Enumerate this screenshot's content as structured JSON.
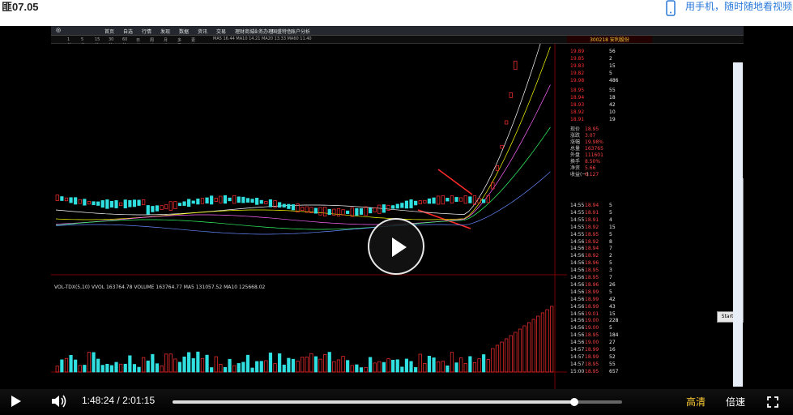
{
  "page": {
    "title": "匪07.05",
    "promo": "用手机，随时随地看视频"
  },
  "app": {
    "menu": [
      "首页",
      "自选",
      "行情",
      "发现",
      "数据",
      "资讯",
      "交易",
      "理财商城",
      "业务办理",
      "国盛特色",
      "账户分析"
    ],
    "periods": [
      "1分钟",
      "5分钟",
      "15分钟",
      "30分钟",
      "60分钟",
      "日线",
      "周线",
      "月线",
      "多周期",
      "更多"
    ],
    "chart_legend": "MA5 16.44  MA10 14.21  MA20 13.33  MA60 11.40",
    "volume_legend": "VOL-TDX(5,10)  VVOL 163764.78  VOLUME 163764.77  MA5 131057.52  MA10 125668.02",
    "indicator_tabs": [
      "指标A",
      "MACD",
      "DMI",
      "DMA",
      "FSL",
      "TRIX",
      "BRAR",
      "CR",
      "VR",
      "OBV",
      "ASI",
      "EMV",
      "VOL-TDX",
      "RSI",
      "WR",
      "SAR",
      "KDJ",
      "CCI",
      "ROC",
      "MTM",
      "BOLL",
      "PSY",
      "MCST",
      "更多"
    ]
  },
  "stock": {
    "code": "300218",
    "name": "安利股份",
    "asks": [
      {
        "label": "卖五",
        "price": "19.89",
        "vol": "56"
      },
      {
        "label": "卖四",
        "price": "19.85",
        "vol": "2"
      },
      {
        "label": "卖三",
        "price": "19.83",
        "vol": "15"
      },
      {
        "label": "卖二",
        "price": "19.82",
        "vol": "5"
      },
      {
        "label": "卖一",
        "price": "19.98",
        "vol": "486"
      }
    ],
    "bids": [
      {
        "label": "买一",
        "price": "18.95",
        "vol": "55"
      },
      {
        "label": "买二",
        "price": "18.94",
        "vol": "18"
      },
      {
        "label": "买三",
        "price": "18.93",
        "vol": "42"
      },
      {
        "label": "买四",
        "price": "18.92",
        "vol": "10"
      },
      {
        "label": "买五",
        "price": "18.91",
        "vol": "19"
      }
    ],
    "stats": [
      {
        "label": "现价",
        "value": "18.95"
      },
      {
        "label": "涨跌",
        "value": "3.07"
      },
      {
        "label": "涨幅",
        "value": "19.98%"
      },
      {
        "label": "总量",
        "value": "163765"
      },
      {
        "label": "外盘",
        "value": "111601"
      },
      {
        "label": "换手",
        "value": "8.50%"
      },
      {
        "label": "净资",
        "value": "5.66"
      },
      {
        "label": "收益(一)",
        "value": "0.127"
      }
    ],
    "trades": [
      {
        "time": "14:55",
        "price": "18.94",
        "vol": "5"
      },
      {
        "time": "14:55",
        "price": "18.91",
        "vol": "5"
      },
      {
        "time": "14:55",
        "price": "18.91",
        "vol": "4"
      },
      {
        "time": "14:55",
        "price": "18.92",
        "vol": "15"
      },
      {
        "time": "14:55",
        "price": "18.95",
        "vol": "5"
      },
      {
        "time": "14:56",
        "price": "18.92",
        "vol": "8"
      },
      {
        "time": "14:56",
        "price": "18.94",
        "vol": "7"
      },
      {
        "time": "14:56",
        "price": "18.92",
        "vol": "2"
      },
      {
        "time": "14:56",
        "price": "18.96",
        "vol": "5"
      },
      {
        "time": "14:56",
        "price": "18.95",
        "vol": "3"
      },
      {
        "time": "14:56",
        "price": "18.95",
        "vol": "7"
      },
      {
        "time": "14:56",
        "price": "18.96",
        "vol": "26"
      },
      {
        "time": "14:56",
        "price": "18.99",
        "vol": "5"
      },
      {
        "time": "14:56",
        "price": "18.99",
        "vol": "42"
      },
      {
        "time": "14:56",
        "price": "18.99",
        "vol": "43"
      },
      {
        "time": "14:56",
        "price": "19.01",
        "vol": "15"
      },
      {
        "time": "14:56",
        "price": "19.00",
        "vol": "228"
      },
      {
        "time": "14:56",
        "price": "19.00",
        "vol": "5"
      },
      {
        "time": "14:56",
        "price": "18.95",
        "vol": "184"
      },
      {
        "time": "14:56",
        "price": "19.00",
        "vol": "27"
      },
      {
        "time": "14:57",
        "price": "18.99",
        "vol": "16"
      },
      {
        "time": "14:57",
        "price": "18.99",
        "vol": "52"
      },
      {
        "time": "14:57",
        "price": "18.95",
        "vol": "55"
      },
      {
        "time": "15:00",
        "price": "18.95",
        "vol": "657"
      }
    ]
  },
  "player": {
    "current": "1:48:24",
    "separator": "/",
    "total": "2:01:15",
    "progress_fraction": 0.894,
    "quality": "高清",
    "speed": "倍速",
    "start_label": "Start"
  },
  "colors": {
    "up": "#ff3030",
    "down": "#30e0e0",
    "accent": "#ffcc33",
    "link": "#2b7ad9"
  }
}
